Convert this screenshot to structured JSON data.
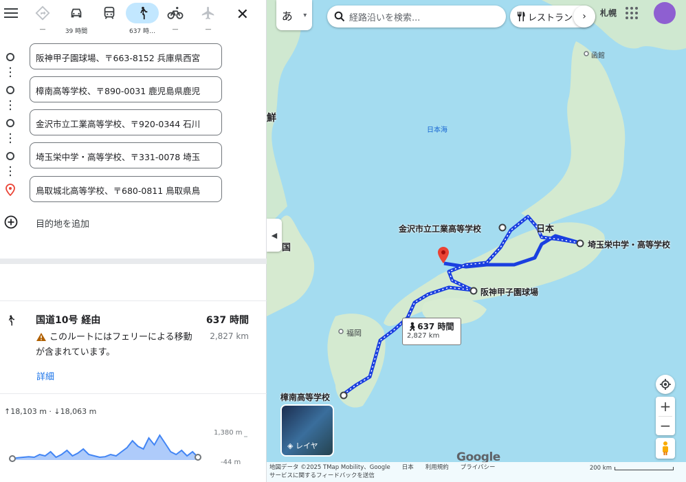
{
  "travel_modes": [
    {
      "name": "best",
      "label": "—"
    },
    {
      "name": "car",
      "label": "39 時間"
    },
    {
      "name": "transit",
      "label": ""
    },
    {
      "name": "walk",
      "label": "637 時…"
    },
    {
      "name": "bike",
      "label": "—"
    },
    {
      "name": "flight",
      "label": "—"
    }
  ],
  "stops": [
    "阪神甲子園球場、〒663-8152 兵庫県西宮",
    "樟南高等学校、〒890-0031 鹿児島県鹿児",
    "金沢市立工業高等学校、〒920-0344 石川",
    "埼玉栄中学・高等学校、〒331-0078 埼玉",
    "鳥取城北高等学校、〒680-0811 鳥取県鳥"
  ],
  "add_destination": "目的地を追加",
  "route": {
    "via": "国道10号 経由",
    "time": "637 時間",
    "distance": "2,827 km",
    "warning": "このルートにはフェリーによる移動が含まれています。",
    "details_link": "詳細"
  },
  "elevation": {
    "up": "18,103 m",
    "down": "18,063 m",
    "max": "1,380 m",
    "min": "-44 m",
    "profile": [
      0.05,
      0.08,
      0.1,
      0.12,
      0.1,
      0.2,
      0.15,
      0.3,
      0.1,
      0.2,
      0.35,
      0.15,
      0.25,
      0.4,
      0.2,
      0.15,
      0.1,
      0.12,
      0.2,
      0.15,
      0.3,
      0.45,
      0.7,
      0.5,
      0.4,
      0.8,
      0.55,
      0.9,
      0.6,
      0.3,
      0.2,
      0.35,
      0.15,
      0.3,
      0.1
    ]
  },
  "map": {
    "lang_btn": "あ",
    "search_placeholder": "経路沿いを検索...",
    "restaurant_chip": "レストラン",
    "sea_label": "日本海",
    "city_sapporo": "札幌",
    "city_hakodate": "函館",
    "city_fukuoka": "福岡",
    "label_nihon": "日本",
    "label_korea_partial": "鮮",
    "label_china_partial": "国",
    "place_kanazawa": "金沢市立工業高等学校",
    "place_saitama": "埼玉栄中学・高等学校",
    "place_koshien": "阪神甲子園球場",
    "place_shonan": "樟南高等学校",
    "bubble_time": "637 時間",
    "bubble_dist": "2,827 km",
    "layer_label": "レイヤ",
    "footer_line1": "地図データ ©2025 TMap Mobility、Google　　日本　　利用規約　　プライバシー",
    "footer_line2": "サービスに関するフィードバックを送信",
    "scale": "200 km",
    "google": "Google"
  }
}
